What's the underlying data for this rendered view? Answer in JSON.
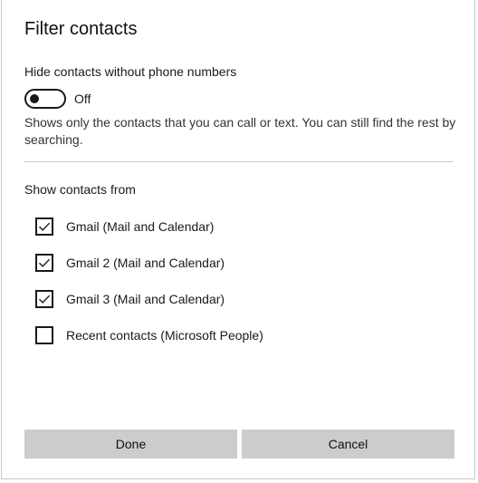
{
  "dialog": {
    "title": "Filter contacts",
    "hide_contacts_label": "Hide contacts without phone numbers",
    "toggle_state": "Off",
    "description": "Shows only the contacts that you can call or text. You can still find the rest by searching.",
    "show_from_label": "Show contacts from",
    "sources": [
      {
        "label": "Gmail (Mail and Calendar)",
        "checked": true
      },
      {
        "label": "Gmail 2 (Mail and Calendar)",
        "checked": true
      },
      {
        "label": "Gmail 3 (Mail and Calendar)",
        "checked": true
      },
      {
        "label": "Recent contacts (Microsoft People)",
        "checked": false
      }
    ],
    "done_label": "Done",
    "cancel_label": "Cancel"
  }
}
